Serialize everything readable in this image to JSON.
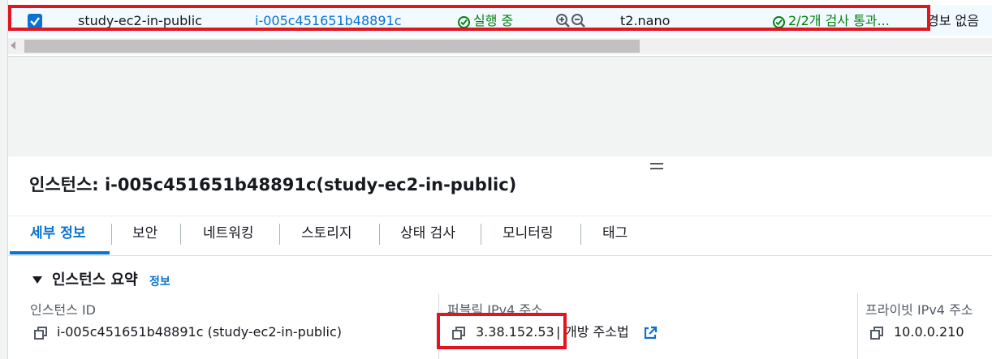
{
  "instance_row": {
    "checked": true,
    "name": "study-ec2-in-public",
    "instance_id": "i-005c451651b48891c",
    "state": "실행 중",
    "instance_type": "t2.nano",
    "status_check": "2/2개 검사 통과...",
    "alarm_status": "경보 없음"
  },
  "details": {
    "title": "인스턴스: i-005c451651b48891c(study-ec2-in-public)",
    "tabs": [
      {
        "label": "세부 정보",
        "active": true
      },
      {
        "label": "보안",
        "active": false
      },
      {
        "label": "네트워킹",
        "active": false
      },
      {
        "label": "스토리지",
        "active": false
      },
      {
        "label": "상태 검사",
        "active": false
      },
      {
        "label": "모니터링",
        "active": false
      },
      {
        "label": "태그",
        "active": false
      }
    ],
    "summary": {
      "title": "인스턴스 요약",
      "info_link": "정보",
      "fields": [
        {
          "label": "인스턴스 ID",
          "value": "i-005c451651b48891c (study-ec2-in-public)"
        },
        {
          "label": "퍼블릭 IPv4 주소",
          "value": "3.38.152.53",
          "extra_link": "개방 주소법"
        },
        {
          "label": "프라이빗 IPv4 주소",
          "value": "10.0.0.210"
        }
      ]
    }
  },
  "colors": {
    "link": "#0972d3",
    "success": "#037f0c",
    "highlight": "#e0151f"
  }
}
